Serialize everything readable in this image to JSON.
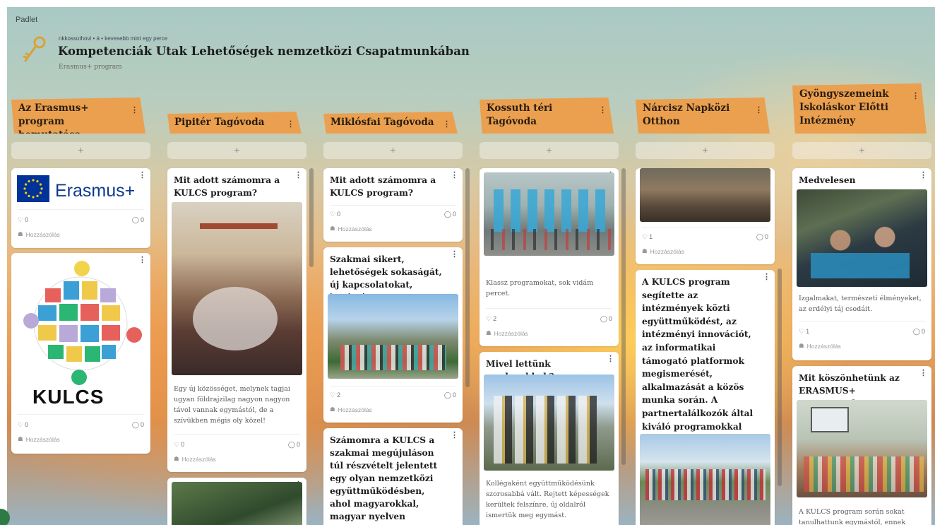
{
  "app": {
    "brand": "Padlet"
  },
  "board": {
    "meta": "nkkossuthovi • á •  kevesebb mint egy perce",
    "title": "Kompetenciák Utak Lehetőségek nemzetközi Csapatmunkában",
    "subtitle": "Erasmus+ program",
    "add_label": "+",
    "comment_label": "Hozzászólás",
    "menu_glyph": "⋮"
  },
  "columns": [
    {
      "title": "Az Erasmus+ program bemutatása",
      "cards": [
        {
          "logo_text": "Erasmus+",
          "likes": "0",
          "comments": "0"
        },
        {
          "logo_text": "KULCS",
          "likes": "0",
          "comments": "0"
        }
      ]
    },
    {
      "title": "Pipitér Tagóvoda",
      "cards": [
        {
          "title": "Mit adott számomra a KULCS program?",
          "body": "Egy új közösséget, melynek tagjai ugyan földrajzilag nagyon nagyon távol vannak egymástól, de a szívükben mégis oly közel!",
          "likes": "0",
          "comments": "0"
        }
      ]
    },
    {
      "title": "Miklósfai Tagóvoda",
      "cards": [
        {
          "title": "Mit adott számomra a KULCS program?",
          "likes": "0",
          "comments": "0"
        },
        {
          "title": "Szakmai sikert, lehetőségek sokaságát, új kapcsolatokat, barátságot.",
          "likes": "2",
          "comments": "0"
        },
        {
          "title": "Számomra a KULCS a szakmai megújuláson túl részvételt jelentett egy olyan nemzetközi együttműködésben, ahol magyarokkal, magyar nyelven tevékenykedtem, s"
        }
      ]
    },
    {
      "title": "Kossuth téri Tagóvoda",
      "cards": [
        {
          "body": "Klassz programokat, sok vidám percet.",
          "likes": "2",
          "comments": "0"
        },
        {
          "title": "Mivel lettünk gazdagabbak?",
          "body": "Kollégaként együttműködésünk szorosabbá vált. Rejtett képességek kerültek felszínre, új oldalról ismertük meg egymást."
        }
      ]
    },
    {
      "title": "Nárcisz Napközi Otthon",
      "cards": [
        {
          "likes": "1",
          "comments": "0"
        },
        {
          "title": "A KULCS program segítette az intézmények közti együttműködést, az intézményi innovációt, az informatikai támogató platformok megismerését, alkalmazását a közös munka során. A partnertalálkozók által kiváló programokkal gyarapodtunk, nagyszerű emberekkel építhettünk kapcsolatokat."
        }
      ]
    },
    {
      "title": "Gyöngyszemeink Iskoláskor Előtti Intézmény",
      "cards": [
        {
          "title": "Medvelesen",
          "body": "Izgalmakat, természeti élményeket, az erdélyi táj csodáit.",
          "likes": "1",
          "comments": "0"
        },
        {
          "title": "Mit köszönhetünk az ERASMUS+ programnak?",
          "body": "A KULCS program során sokat tanulhattunk egymástól, ennek"
        }
      ]
    }
  ],
  "colors": {
    "header_orange": "#eaa04f",
    "eu_blue": "#003399",
    "eu_star": "#ffcc00",
    "erasmus_blue": "#0e3b8c"
  },
  "icons": [
    "key-icon",
    "heart-icon",
    "comment-icon",
    "avatar-icon",
    "kebab-icon"
  ]
}
